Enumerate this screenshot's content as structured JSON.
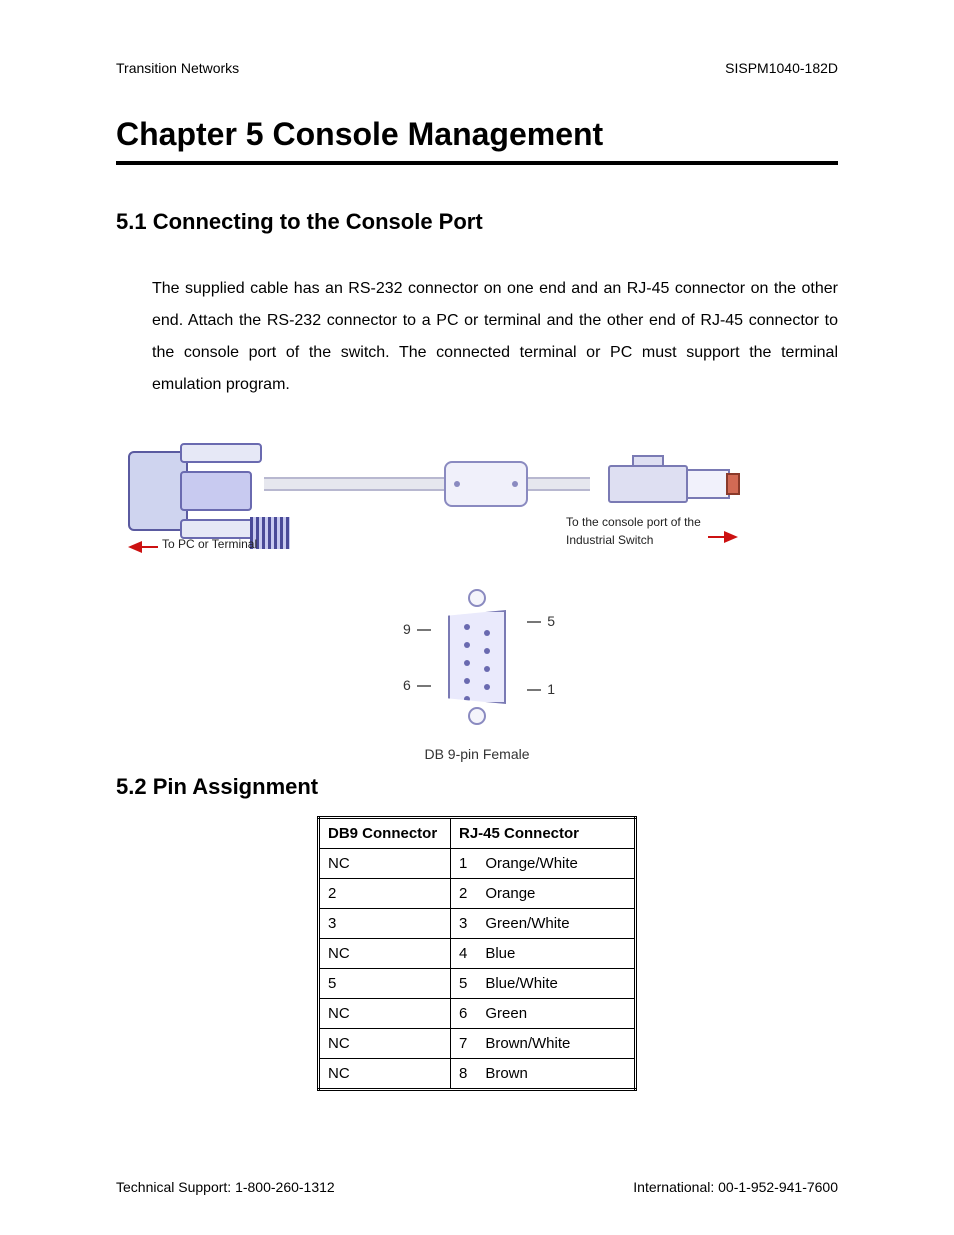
{
  "header": {
    "left": "Transition Networks",
    "right": "SISPM1040-182D"
  },
  "chapter": {
    "title": "Chapter 5  Console Management"
  },
  "sections": {
    "s1": {
      "heading": "5.1  Connecting to the Console Port"
    },
    "s2": {
      "heading": "5.2  Pin Assignment"
    }
  },
  "para1": "The supplied cable has an RS-232 connector on one end and an RJ-45 connector on the other end.   Attach the RS-232 connector to a PC or terminal and the other end of RJ-45 connector to the console port of the switch. The connected terminal or PC must support the terminal emulation program.",
  "cable_diagram": {
    "left_label": "To PC or Terminal",
    "right_label": "To the console port of the Industrial Switch"
  },
  "db9_face": {
    "caption": "DB 9-pin Female",
    "pins": {
      "p9": "9",
      "p6": "6",
      "p5": "5",
      "p1": "1"
    }
  },
  "pin_table": {
    "headers": {
      "db9": "DB9 Connector",
      "rj45": "RJ-45 Connector"
    },
    "rows": [
      {
        "db9": "NC",
        "num": "1",
        "color": "Orange/White"
      },
      {
        "db9": "2",
        "num": "2",
        "color": "Orange"
      },
      {
        "db9": "3",
        "num": "3",
        "color": "Green/White"
      },
      {
        "db9": "NC",
        "num": "4",
        "color": "Blue"
      },
      {
        "db9": "5",
        "num": "5",
        "color": "Blue/White"
      },
      {
        "db9": "NC",
        "num": "6",
        "color": "Green"
      },
      {
        "db9": "NC",
        "num": "7",
        "color": "Brown/White"
      },
      {
        "db9": "NC",
        "num": "8",
        "color": "Brown"
      }
    ]
  },
  "footer": {
    "left": "Technical Support: 1-800-260-1312",
    "right": "International: 00-1-952-941-7600"
  }
}
